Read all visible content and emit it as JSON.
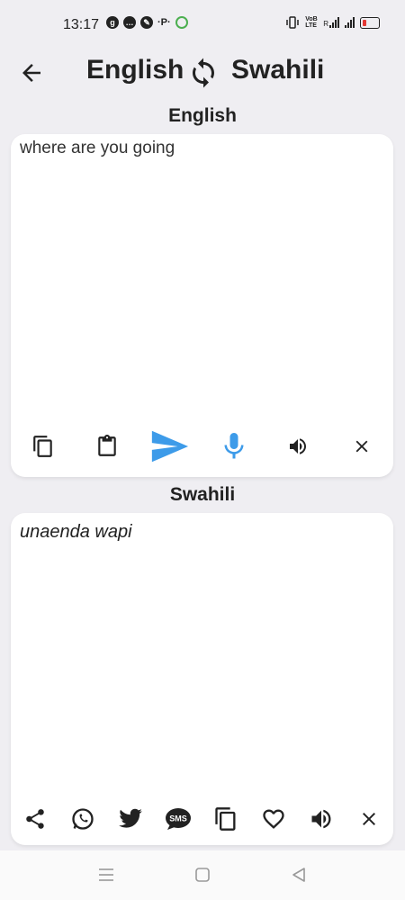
{
  "status_bar": {
    "time": "13:17",
    "volte_text": "VoB LTE",
    "network_r": "R"
  },
  "header": {
    "from_language": "English",
    "to_language": "Swahili"
  },
  "source": {
    "label": "English",
    "text": "where are you going"
  },
  "target": {
    "label": "Swahili",
    "text": "unaenda wapi"
  },
  "colors": {
    "accent": "#3d9be9",
    "background": "#efeef2",
    "battery_low": "#e53935"
  },
  "source_toolbar_icons": [
    "copy-icon",
    "paste-icon",
    "send-icon",
    "mic-icon",
    "speaker-icon",
    "clear-icon"
  ],
  "target_toolbar_icons": [
    "share-icon",
    "whatsapp-icon",
    "twitter-icon",
    "sms-icon",
    "copy-icon",
    "favorite-icon",
    "speaker-icon",
    "clear-icon"
  ],
  "sms_icon_text": "SMS"
}
